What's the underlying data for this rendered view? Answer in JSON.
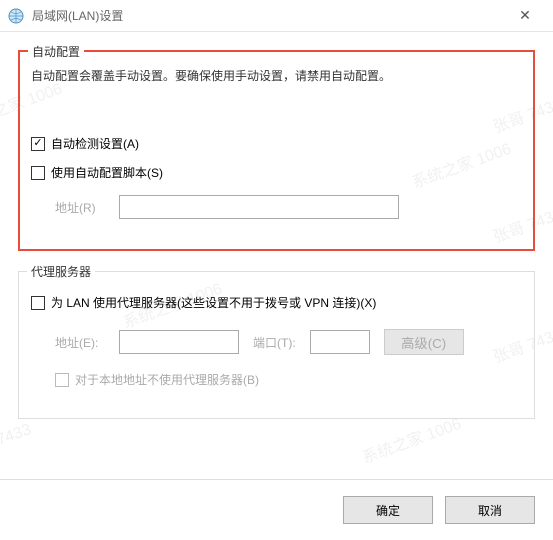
{
  "window": {
    "title": "局域网(LAN)设置",
    "close": "✕"
  },
  "auto_config": {
    "legend": "自动配置",
    "desc": "自动配置会覆盖手动设置。要确保使用手动设置，请禁用自动配置。",
    "auto_detect": {
      "label": "自动检测设置(A)",
      "checked": "✓"
    },
    "use_script": {
      "label": "使用自动配置脚本(S)"
    },
    "address_label": "地址(R)",
    "address_value": ""
  },
  "proxy": {
    "legend": "代理服务器",
    "use_proxy": {
      "label": "为 LAN 使用代理服务器(这些设置不用于拨号或 VPN 连接)(X)"
    },
    "address_label": "地址(E):",
    "address_value": "",
    "port_label": "端口(T):",
    "port_value": "",
    "advanced": "高级(C)",
    "bypass_local": {
      "label": "对于本地地址不使用代理服务器(B)"
    }
  },
  "buttons": {
    "ok": "确定",
    "cancel": "取消"
  },
  "watermarks": {
    "a": "系统之家 1006",
    "b": "张哥 7433"
  }
}
